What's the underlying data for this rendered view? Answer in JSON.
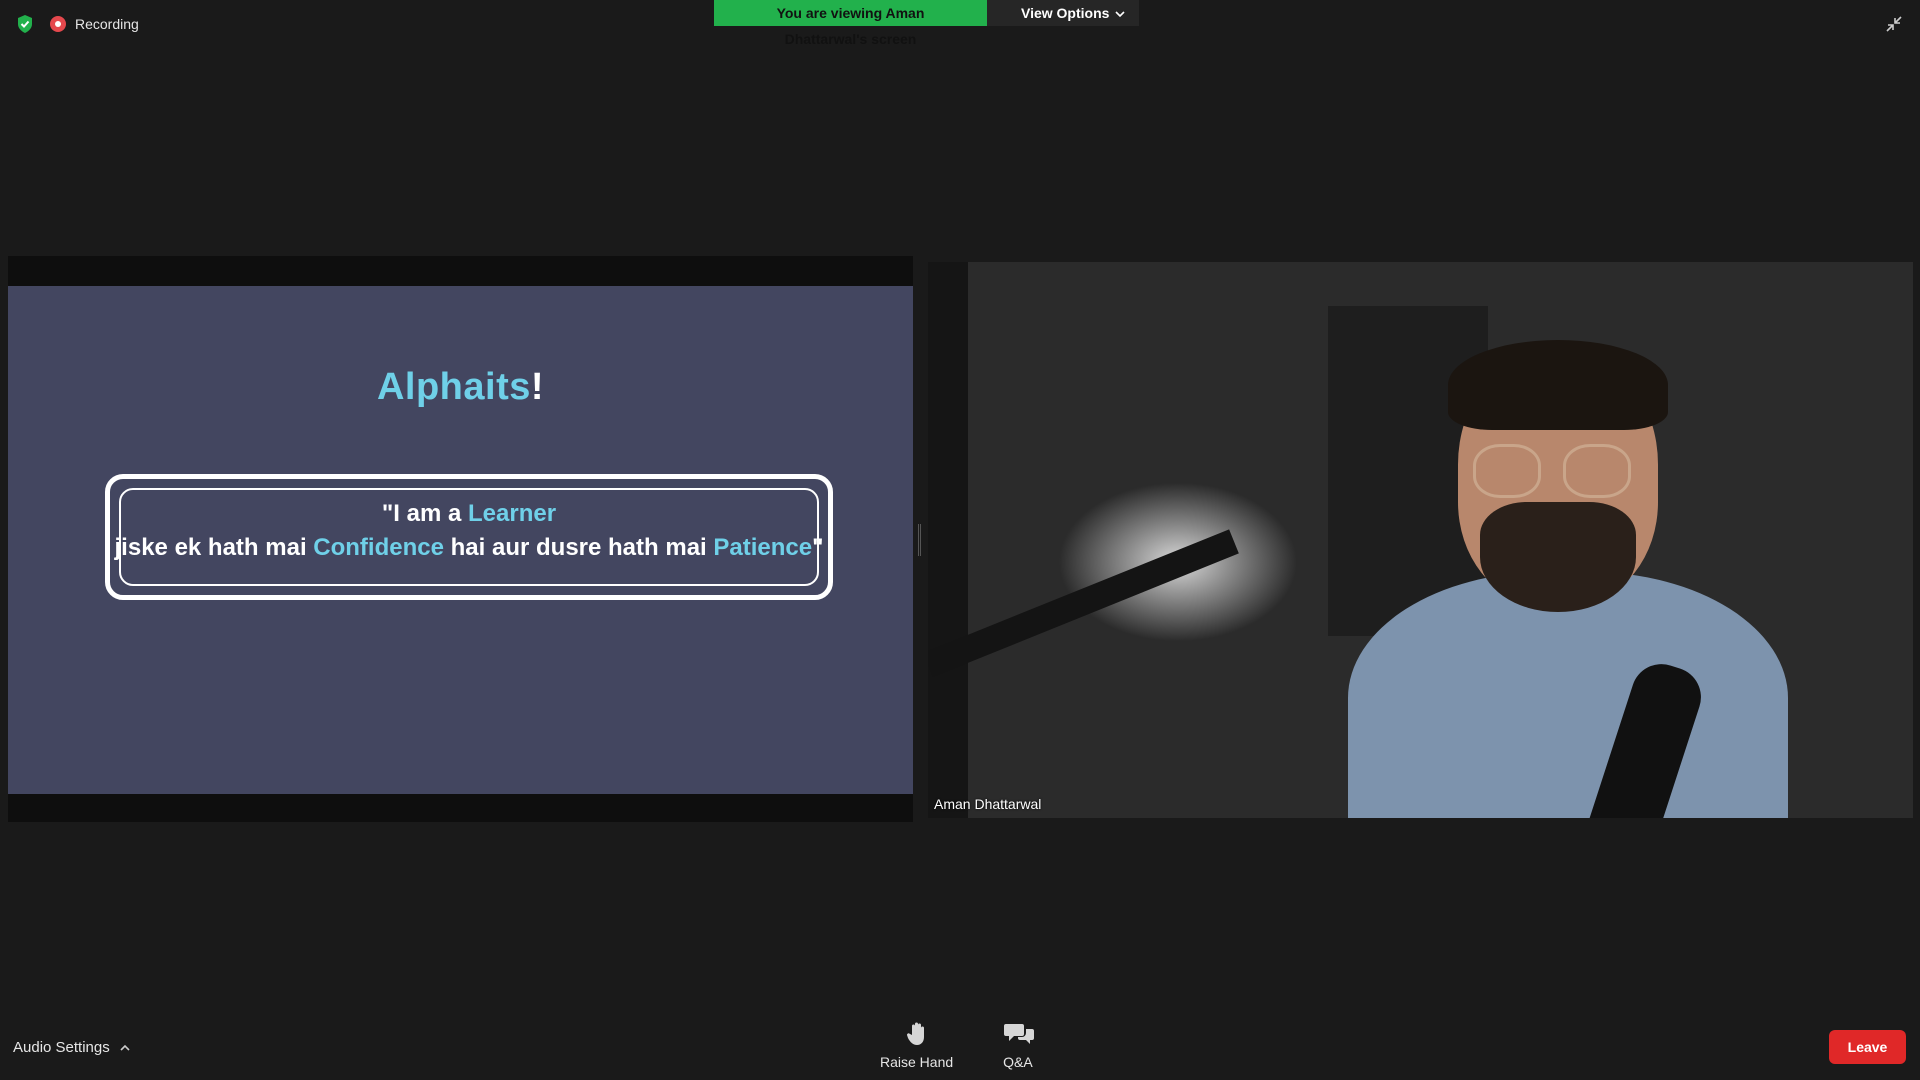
{
  "topbar": {
    "recording_label": "Recording",
    "viewing_banner": "You are viewing Aman Dhattarwal's screen",
    "view_options_label": "View Options"
  },
  "slide": {
    "title_main": "Alphaits",
    "title_suffix": "!",
    "quote": {
      "line1_prefix": "\"I am a ",
      "line1_accent": "Learner",
      "line2_part1": "jiske ek hath mai ",
      "line2_accent1": "Confidence",
      "line2_part2": " hai aur dusre hath mai ",
      "line2_accent2": "Patience",
      "line2_suffix": "\""
    }
  },
  "video": {
    "participant_name": "Aman Dhattarwal"
  },
  "bottombar": {
    "audio_settings_label": "Audio Settings",
    "raise_hand_label": "Raise Hand",
    "qa_label": "Q&A",
    "leave_label": "Leave"
  },
  "colors": {
    "banner_green": "#22b14c",
    "leave_red": "#e02828",
    "slide_bg": "#434660",
    "slide_accent": "#6fd0e8"
  },
  "icons": [
    "shield-icon",
    "record-icon",
    "chevron-down-icon",
    "minimize-icon",
    "chevron-up-icon",
    "raise-hand-icon",
    "qa-icon"
  ]
}
